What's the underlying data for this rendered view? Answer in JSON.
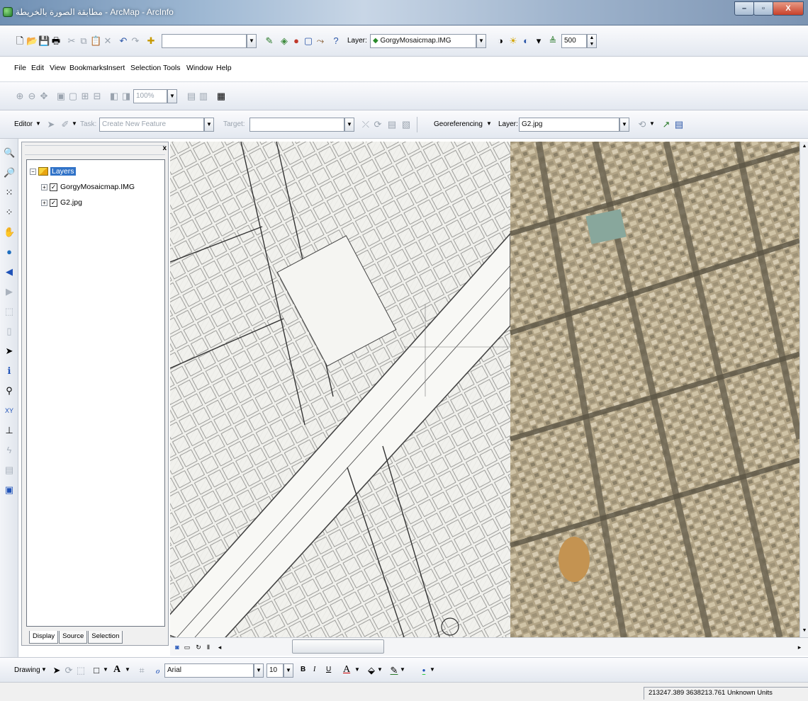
{
  "window": {
    "title": "مطابقة الصورة بالخريطة - ArcMap - ArcInfo",
    "minimize": "–",
    "maximize": "▫",
    "close": "X"
  },
  "standard_toolbar": {
    "scale_value": "",
    "layer_label": "Layer:",
    "layer_value": "GorgyMosaicmap.IMG",
    "contrast_value": "500"
  },
  "menu": {
    "items": [
      "File",
      "Edit",
      "View",
      "Bookmarks",
      "Insert",
      "Selection",
      "Tools",
      "Window",
      "Help"
    ]
  },
  "layout_toolbar": {
    "zoom_percent": "100%"
  },
  "editor_toolbar": {
    "editor_label": "Editor",
    "task_label": "Task:",
    "task_value": "Create New Feature",
    "target_label": "Target:",
    "target_value": "",
    "georeferencing_label": "Georeferencing",
    "layer_label": "Layer:",
    "layer_value": "G2.jpg"
  },
  "toc": {
    "root_label": "Layers",
    "layers": [
      {
        "name": "GorgyMosaicmap.IMG",
        "checked": true
      },
      {
        "name": "G2.jpg",
        "checked": true
      }
    ],
    "tabs": [
      "Display",
      "Source",
      "Selection"
    ],
    "active_tab": "Display"
  },
  "drawing_toolbar": {
    "drawing_label": "Drawing",
    "text_tool": "A",
    "font_name": "Arial",
    "font_size": "10",
    "bold": "B",
    "italic": "I",
    "underline": "U",
    "font_color_glyph": "A"
  },
  "status": {
    "coordinates": "213247.389  3638213.761 Unknown Units"
  },
  "colors": {
    "selection": "#3173c8",
    "title_bar": "#9eb8d3"
  }
}
